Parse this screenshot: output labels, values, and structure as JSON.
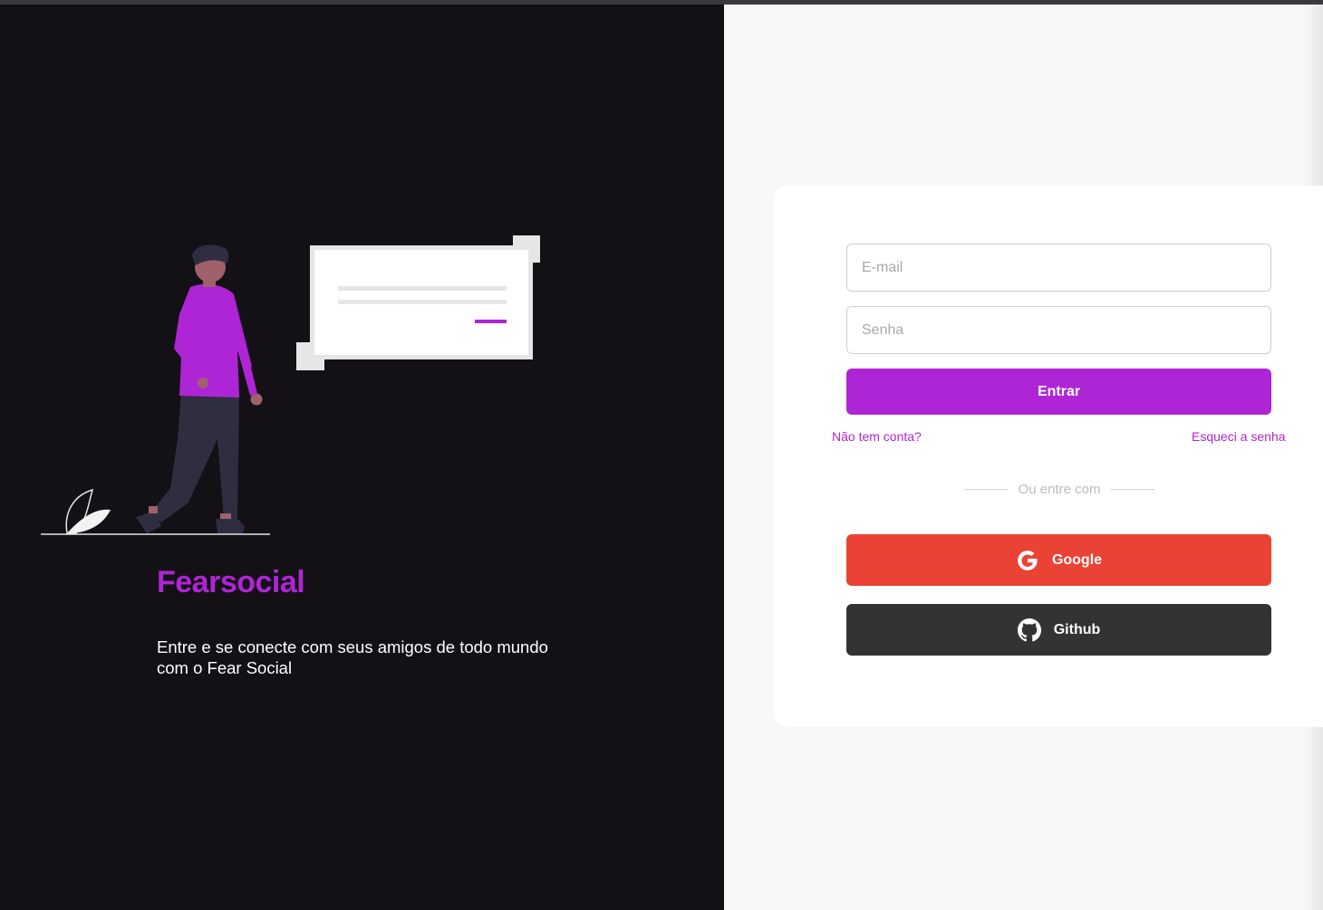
{
  "brand": {
    "title": "Fearsocial",
    "description": "Entre e se conecte com seus amigos de todo mundo com o Fear Social"
  },
  "form": {
    "email_placeholder": "E-mail",
    "password_placeholder": "Senha",
    "submit_label": "Entrar",
    "signup_link": "Não tem conta?",
    "forgot_link": "Esqueci a senha",
    "divider_text": "Ou entre com"
  },
  "social": {
    "google_label": "Google",
    "github_label": "Github",
    "google_icon": "google-icon",
    "github_icon": "github-icon"
  },
  "colors": {
    "accent": "#ae25d6",
    "google": "#ea4335",
    "github": "#333333",
    "left_bg": "#131016",
    "right_bg": "#f8f8f8"
  }
}
